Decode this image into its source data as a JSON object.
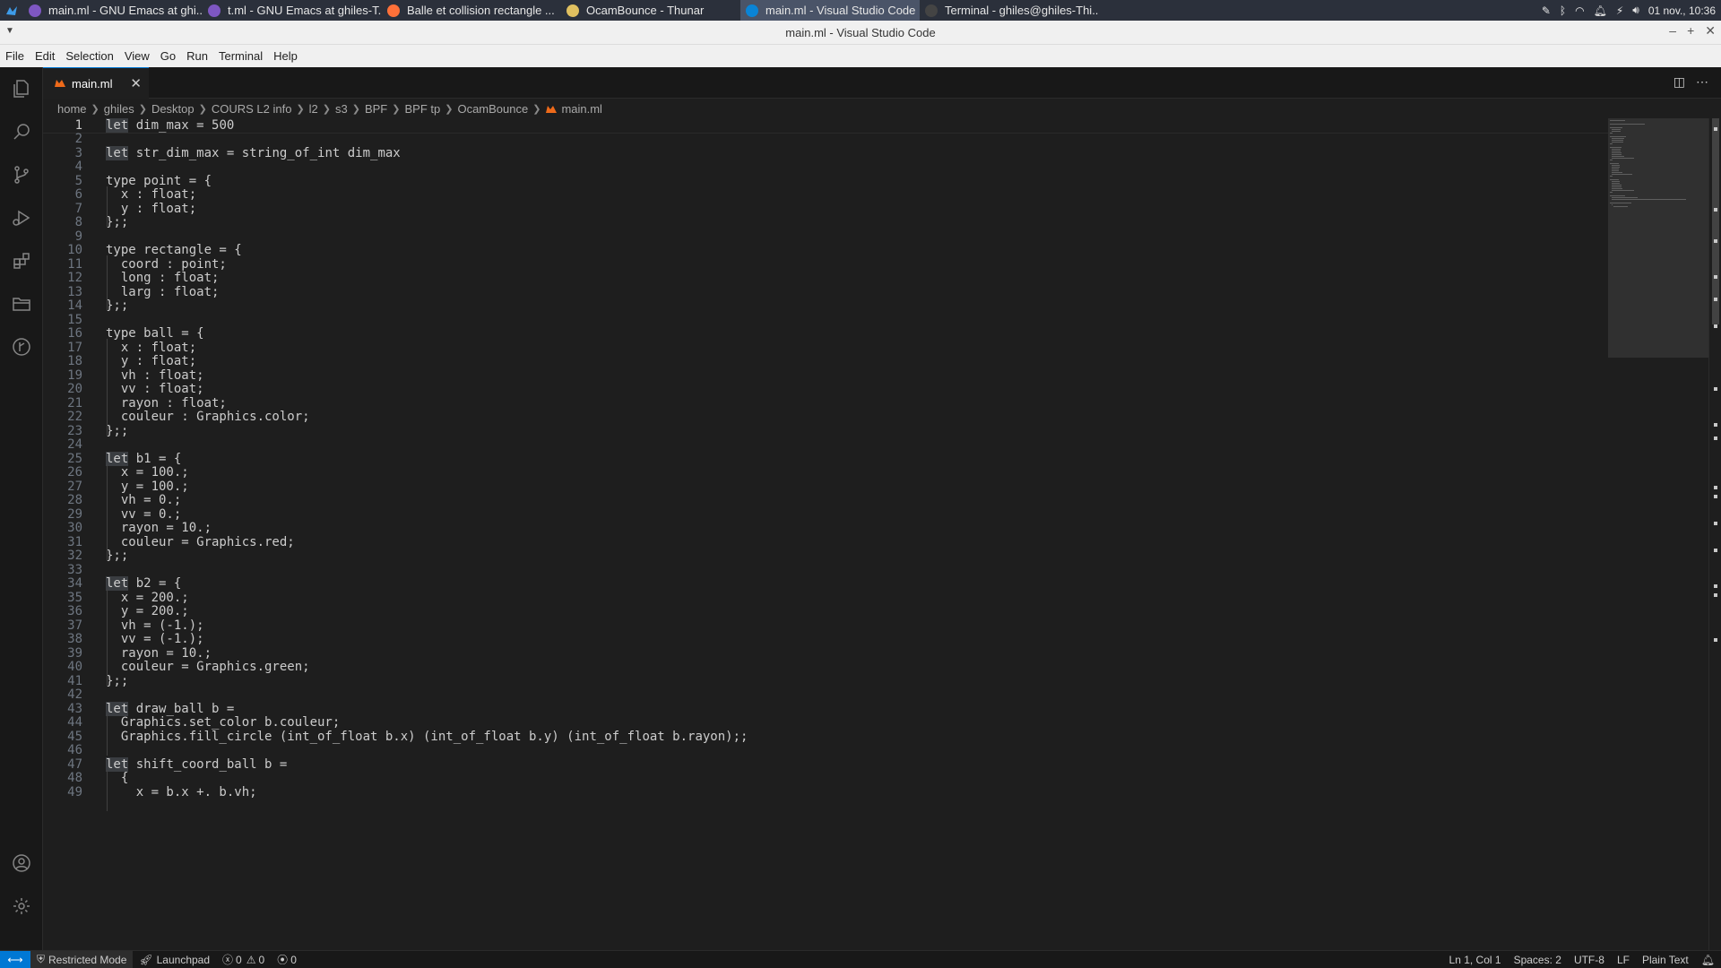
{
  "taskbar": {
    "tasks": [
      {
        "label": "main.ml - GNU Emacs at ghi...",
        "icon": "emacs-icon",
        "color": "#7e57c2"
      },
      {
        "label": "t.ml - GNU Emacs at ghiles-T...",
        "icon": "emacs-icon",
        "color": "#7e57c2"
      },
      {
        "label": "Balle et collision rectangle ...",
        "icon": "firefox-icon",
        "color": "#ff7139"
      },
      {
        "label": "OcamBounce - Thunar",
        "icon": "folder-icon",
        "color": "#e0c060"
      },
      {
        "label": "main.ml - Visual Studio Code",
        "icon": "vscode-icon",
        "color": "#0a84d6"
      },
      {
        "label": "Terminal - ghiles@ghiles-Thi...",
        "icon": "terminal-icon",
        "color": "#444444"
      }
    ],
    "clock": "01 nov., 10:36"
  },
  "window": {
    "title": "main.ml - Visual Studio Code"
  },
  "menu": [
    "File",
    "Edit",
    "Selection",
    "View",
    "Go",
    "Run",
    "Terminal",
    "Help"
  ],
  "tab": {
    "label": "main.ml"
  },
  "breadcrumb": [
    "home",
    "ghiles",
    "Desktop",
    "COURS L2 info",
    "l2",
    "s3",
    "BPF",
    "BPF tp",
    "OcamBounce",
    "main.ml"
  ],
  "editor": {
    "current_line": 1,
    "lines": [
      "let dim_max = 500",
      "",
      "let str_dim_max = string_of_int dim_max",
      "",
      "type point = {",
      "  x : float;",
      "  y : float;",
      "};;",
      "",
      "type rectangle = {",
      "  coord : point;",
      "  long : float;",
      "  larg : float;",
      "};;",
      "",
      "type ball = {",
      "  x : float;",
      "  y : float;",
      "  vh : float;",
      "  vv : float;",
      "  rayon : float;",
      "  couleur : Graphics.color;",
      "};;",
      "",
      "let b1 = {",
      "  x = 100.;",
      "  y = 100.;",
      "  vh = 0.;",
      "  vv = 0.;",
      "  rayon = 10.;",
      "  couleur = Graphics.red;",
      "};;",
      "",
      "let b2 = {",
      "  x = 200.;",
      "  y = 200.;",
      "  vh = (-1.);",
      "  vv = (-1.);",
      "  rayon = 10.;",
      "  couleur = Graphics.green;",
      "};;",
      "",
      "let draw_ball b =",
      "  Graphics.set_color b.couleur;",
      "  Graphics.fill_circle (int_of_float b.x) (int_of_float b.y) (int_of_float b.rayon);;",
      "",
      "let shift_coord_ball b =",
      "  {",
      "    x = b.x +. b.vh;"
    ]
  },
  "status": {
    "restricted": "Restricted Mode",
    "launchpad": "Launchpad",
    "errors": "0",
    "warnings": "0",
    "ports": "0",
    "position": "Ln 1, Col 1",
    "spaces": "Spaces: 2",
    "encoding": "UTF-8",
    "eol": "LF",
    "language": "Plain Text"
  },
  "colors": {
    "accent": "#0078d4",
    "editor_bg": "#1e1e1e",
    "keyword_highlight": "#3a3d41"
  }
}
